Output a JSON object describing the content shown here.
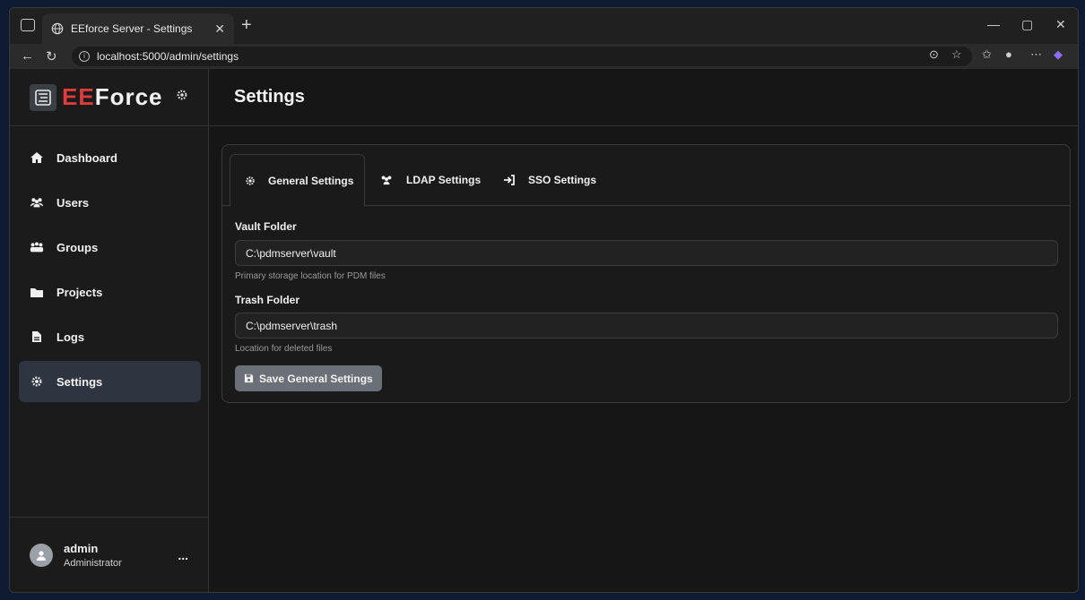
{
  "browser": {
    "tab_title": "EEforce Server - Settings",
    "url": "localhost:5000/admin/settings",
    "icons": [
      "tab-strip-icon",
      "globe-icon",
      "close-icon",
      "new-tab-icon",
      "back-icon",
      "refresh-icon",
      "info-icon",
      "reader-icon",
      "favorite-icon",
      "favorites-icon",
      "profile-icon",
      "more-icon",
      "copilot-icon",
      "minimize-icon",
      "maximize-icon",
      "window-close-icon"
    ]
  },
  "sidebar": {
    "brand_ee": "EE",
    "brand_force": "Force",
    "items": [
      {
        "label": "Dashboard",
        "icon": "home-icon"
      },
      {
        "label": "Users",
        "icon": "users-icon"
      },
      {
        "label": "Groups",
        "icon": "groups-icon"
      },
      {
        "label": "Projects",
        "icon": "folder-icon"
      },
      {
        "label": "Logs",
        "icon": "file-icon"
      },
      {
        "label": "Settings",
        "icon": "gear-icon"
      }
    ],
    "user": {
      "name": "admin",
      "role": "Administrator",
      "more": "..."
    }
  },
  "header": {
    "title": "Settings"
  },
  "tabs": [
    {
      "label": "General Settings",
      "icon": "gear-icon"
    },
    {
      "label": "LDAP Settings",
      "icon": "users-icon"
    },
    {
      "label": "SSO Settings",
      "icon": "sign-in-icon"
    }
  ],
  "form": {
    "vault": {
      "label": "Vault Folder",
      "value": "C:\\pdmserver\\vault",
      "help": "Primary storage location for PDM files"
    },
    "trash": {
      "label": "Trash Folder",
      "value": "C:\\pdmserver\\trash",
      "help": "Location for deleted files"
    },
    "save_label": "Save General Settings"
  },
  "colors": {
    "active_nav": "#2f3441",
    "brand_red": "#e03a3a",
    "save_button": "#6b6f78"
  }
}
